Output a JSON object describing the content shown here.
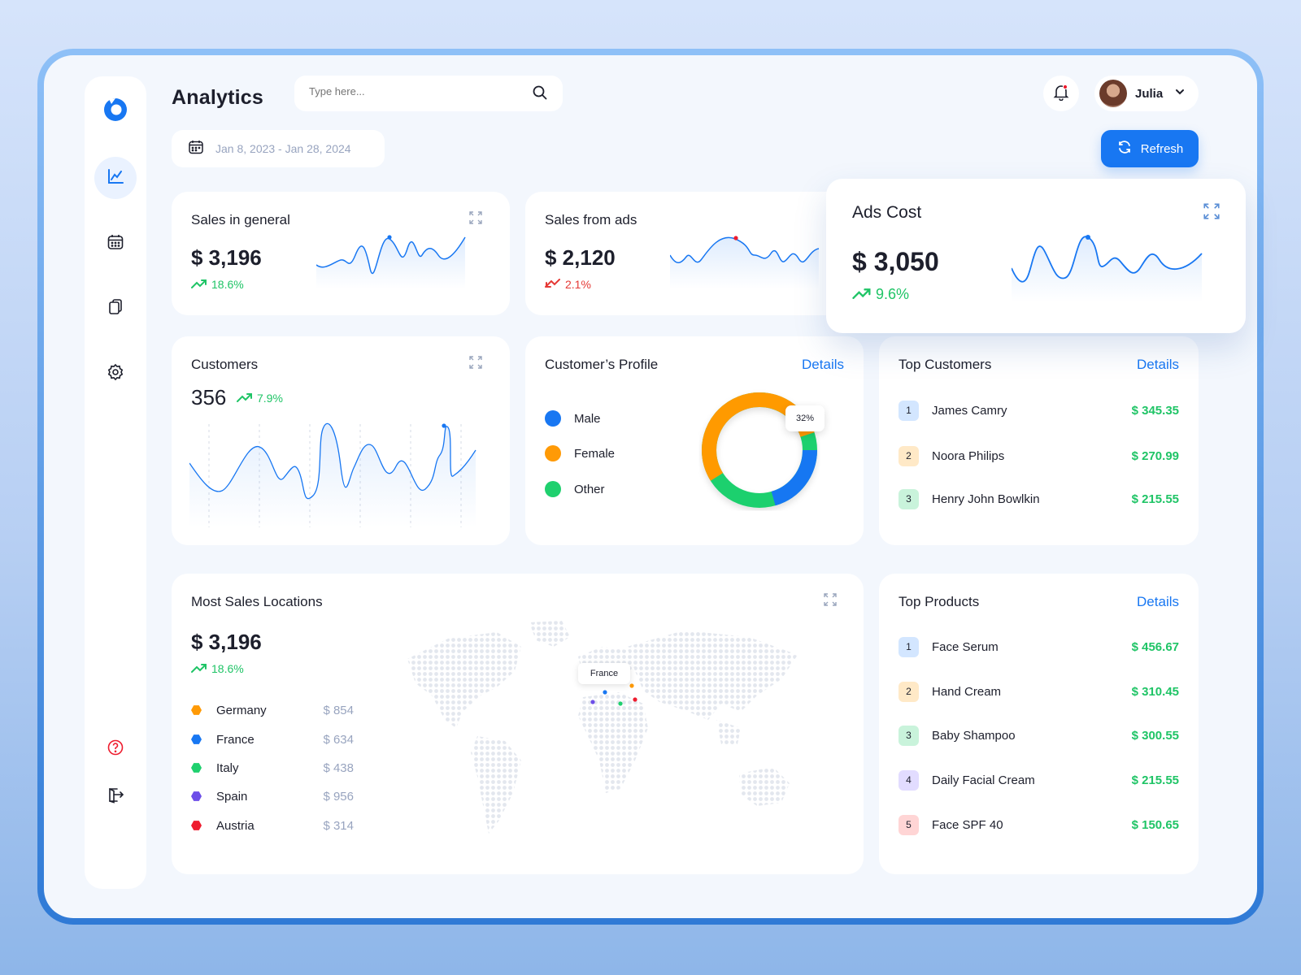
{
  "header": {
    "title": "Analytics",
    "search_placeholder": "Type here...",
    "user_name": "Julia",
    "date_range": "Jan 8, 2023 - Jan 28, 2024",
    "refresh_label": "Refresh"
  },
  "sidebar": {
    "items": [
      {
        "name": "analytics",
        "icon": "chart-icon",
        "active": true
      },
      {
        "name": "calendar",
        "icon": "calendar-icon",
        "active": false
      },
      {
        "name": "documents",
        "icon": "documents-icon",
        "active": false
      },
      {
        "name": "settings",
        "icon": "gear-icon",
        "active": false
      }
    ],
    "bottom": [
      {
        "name": "help",
        "icon": "help-icon"
      },
      {
        "name": "logout",
        "icon": "logout-icon"
      }
    ]
  },
  "cards": {
    "sales_general": {
      "title": "Sales in general",
      "value": "$ 3,196",
      "change": "18.6%",
      "trend": "up"
    },
    "sales_ads": {
      "title": "Sales from ads",
      "value": "$ 2,120",
      "change": "2.1%",
      "trend": "down"
    },
    "ads_cost": {
      "title": "Ads Cost",
      "value": "$ 3,050",
      "change": "9.6%",
      "trend": "up"
    },
    "customers": {
      "title": "Customers",
      "value": "356",
      "change": "7.9%",
      "trend": "up"
    },
    "profile": {
      "title": "Customer’s Profile",
      "details": "Details",
      "tooltip": "32%",
      "legend": [
        {
          "label": "Male",
          "color": "#1877f2"
        },
        {
          "label": "Female",
          "color": "#ff9a06"
        },
        {
          "label": "Other",
          "color": "#1fd06e"
        }
      ]
    },
    "top_customers": {
      "title": "Top Customers",
      "details": "Details",
      "rows": [
        {
          "rank": "1",
          "name": "James Camry",
          "value": "$ 345.35"
        },
        {
          "rank": "2",
          "name": "Noora Philips",
          "value": "$ 270.99"
        },
        {
          "rank": "3",
          "name": "Henry John Bowlkin",
          "value": "$ 215.55"
        }
      ]
    },
    "locations": {
      "title": "Most Sales Locations",
      "value": "$ 3,196",
      "change": "18.6%",
      "map_label": "France",
      "rows": [
        {
          "country": "Germany",
          "value": "$ 854",
          "color": "#ff9a06"
        },
        {
          "country": "France",
          "value": "$ 634",
          "color": "#1877f2"
        },
        {
          "country": "Italy",
          "value": "$ 438",
          "color": "#1fd06e"
        },
        {
          "country": "Spain",
          "value": "$ 956",
          "color": "#6d4ee8"
        },
        {
          "country": "Austria",
          "value": "$ 314",
          "color": "#ee1c2e"
        }
      ]
    },
    "top_products": {
      "title": "Top Products",
      "details": "Details",
      "rows": [
        {
          "rank": "1",
          "name": "Face Serum",
          "value": "$ 456.67"
        },
        {
          "rank": "2",
          "name": "Hand Cream",
          "value": "$ 310.45"
        },
        {
          "rank": "3",
          "name": "Baby Shampoo",
          "value": "$ 300.55"
        },
        {
          "rank": "4",
          "name": "Daily Facial Cream",
          "value": "$ 215.55"
        },
        {
          "rank": "5",
          "name": "Face SPF 40",
          "value": "$ 150.65"
        }
      ]
    }
  },
  "colors": {
    "accent": "#1877f2",
    "positive": "#1fc466",
    "negative": "#e53935",
    "rank1": "#d3e6ff",
    "rank2": "#ffe9c7",
    "rank3": "#c9f3db",
    "rank4": "#e2dcff",
    "rank5": "#ffd5d5"
  }
}
